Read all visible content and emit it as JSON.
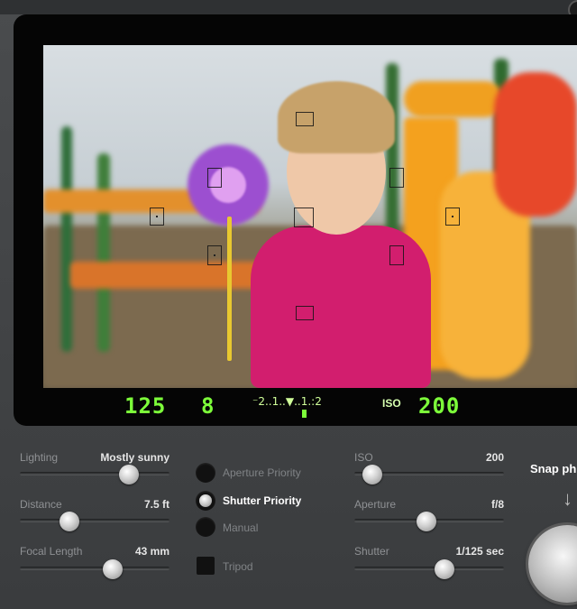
{
  "viewfinder": {
    "shutter_display": "125",
    "aperture_display": "8",
    "meter_scale": "⁻2..1..▼..1.:2",
    "iso_label": "ISO",
    "iso_display": "200"
  },
  "controls": {
    "lighting": {
      "label": "Lighting",
      "value": "Mostly sunny",
      "level": 0.73
    },
    "distance": {
      "label": "Distance",
      "value": "7.5 ft",
      "level": 0.33
    },
    "focal_length": {
      "label": "Focal Length",
      "value": "43 mm",
      "level": 0.62
    },
    "iso": {
      "label": "ISO",
      "value": "200",
      "level": 0.12
    },
    "aperture": {
      "label": "Aperture",
      "value": "f/8",
      "level": 0.48
    },
    "shutter": {
      "label": "Shutter",
      "value": "1/125 sec",
      "level": 0.6
    }
  },
  "modes": {
    "aperture_priority": "Aperture Priority",
    "shutter_priority": "Shutter Priority",
    "manual": "Manual",
    "selected": "Shutter Priority"
  },
  "tripod": {
    "label": "Tripod",
    "checked": false
  },
  "snap": {
    "label": "Snap ph"
  },
  "colors": {
    "lcd_green": "#7dff3a",
    "panel_bg": "#444648"
  }
}
